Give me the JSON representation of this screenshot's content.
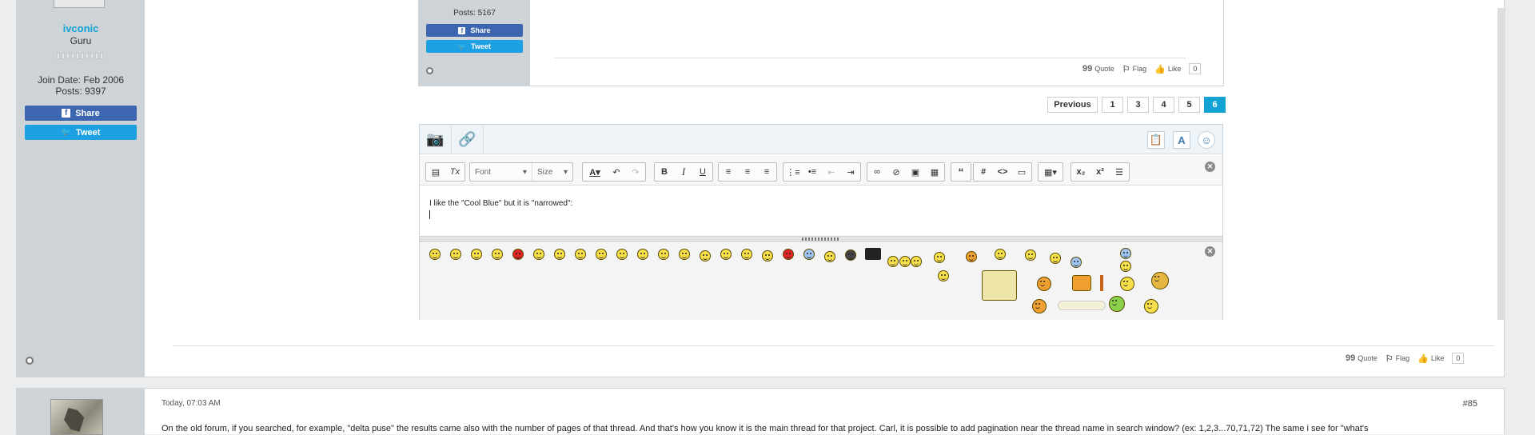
{
  "outer_post": {
    "username": "ivconic",
    "rank": "Guru",
    "join_date": "Join Date: Feb 2006",
    "posts": "Posts: 9397",
    "share_label": "Share",
    "tweet_label": "Tweet",
    "actions": {
      "quote": "Quote",
      "flag": "Flag",
      "like": "Like",
      "like_count": "0"
    }
  },
  "inner_post": {
    "posts": "Posts: 5167",
    "share_label": "Share",
    "tweet_label": "Tweet",
    "actions": {
      "quote": "Quote",
      "flag": "Flag",
      "like": "Like",
      "like_count": "0"
    }
  },
  "pagination": {
    "previous": "Previous",
    "pages": [
      "1",
      "3",
      "4",
      "5",
      "6"
    ],
    "active_page": "6"
  },
  "editor": {
    "font_dropdown": "Font",
    "size_dropdown": "Size",
    "text": "I like the \"Cool Blue\" but it is \"narrowed\":"
  },
  "next_post": {
    "date": "Today, 07:03 AM",
    "post_number": "#85",
    "text": "On the old forum, if you searched, for example, \"delta puse\" the results came also with the number of pages of that thread. And that's how you know it is the main thread for that project. Carl, it is possible to add pagination near the thread name in search window? (ex: 1,2,3...70,71,72) The same i see for \"what's"
  },
  "colors": {
    "accent": "#12a2d4",
    "facebook": "#3d66b0",
    "twitter": "#1da1e2",
    "sidebar": "#ced3d8"
  }
}
